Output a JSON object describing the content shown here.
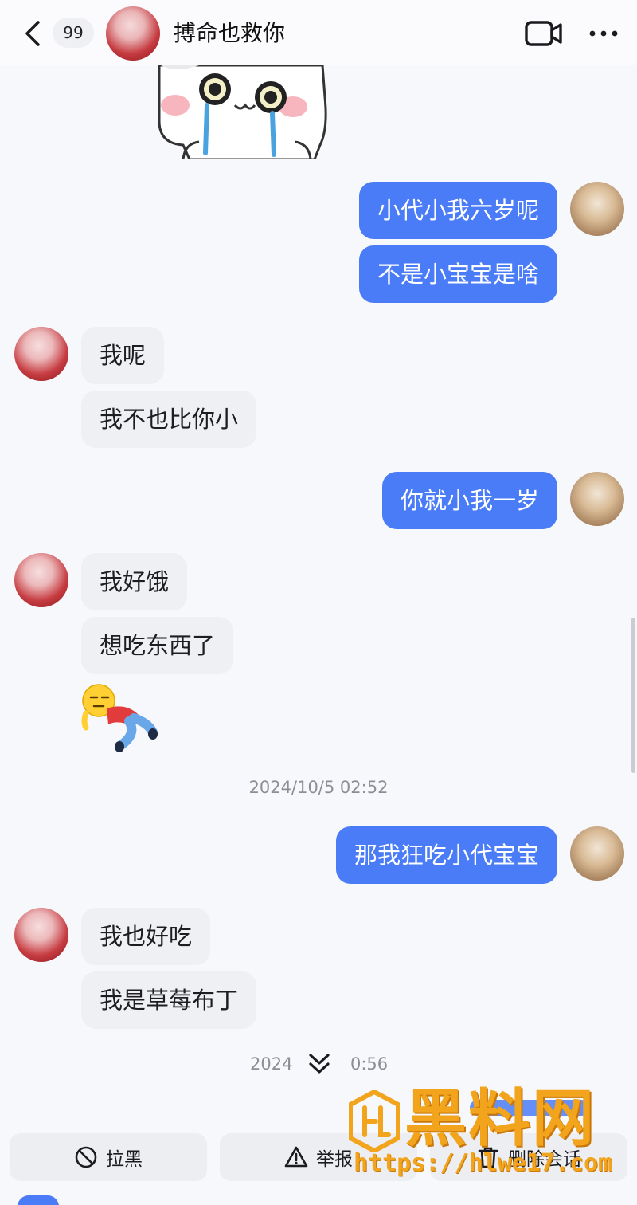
{
  "header": {
    "unread_count": "99",
    "contact_name": "搏命也救你"
  },
  "messages": [
    {
      "side": "out",
      "text": "小代小我六岁呢"
    },
    {
      "side": "out",
      "text": "不是小宝宝是啥"
    },
    {
      "side": "in",
      "text": "我呢"
    },
    {
      "side": "in",
      "text": "我不也比你小"
    },
    {
      "side": "out",
      "text": "你就小我一岁"
    },
    {
      "side": "in",
      "text": "我好饿"
    },
    {
      "side": "in",
      "text": "想吃东西了"
    },
    {
      "side": "out",
      "text": "那我狂吃小代宝宝"
    },
    {
      "side": "in",
      "text": "我也好吃"
    },
    {
      "side": "in",
      "text": "我是草莓布丁"
    }
  ],
  "timestamps": {
    "first": "2024/10/5 02:52",
    "second_left": "2024",
    "second_right": "0:56"
  },
  "actions": {
    "block": "拉黑",
    "report": "举报",
    "delete": "删除会话"
  },
  "watermark": {
    "title": "黑料网",
    "url": "https://hlwe17.com"
  },
  "colors": {
    "outgoing_bubble": "#4a7cf7",
    "incoming_bubble": "#eff0f4",
    "watermark": "#f2a51c"
  },
  "icons": [
    "back-icon",
    "video-call-icon",
    "more-icon",
    "block-icon",
    "report-icon",
    "delete-icon",
    "scroll-down-icon"
  ]
}
